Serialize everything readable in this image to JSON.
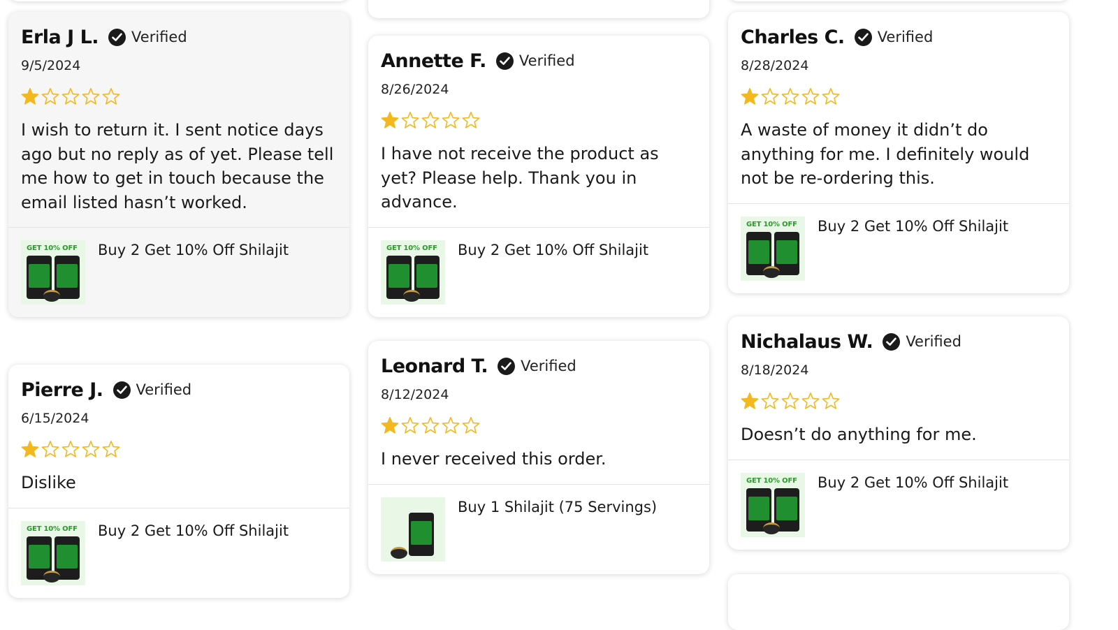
{
  "verified_label": "Verified",
  "colors": {
    "star": "#f2b81d",
    "card": "#ffffff",
    "card_shaded": "#f6f6f6"
  },
  "icons": {
    "verified": "check-circle-icon",
    "star_filled": "star-filled-icon",
    "star_empty": "star-outline-icon"
  },
  "reviews": [
    {
      "name": "Erla J L.",
      "date": "9/5/2024",
      "rating": 1,
      "max_rating": 5,
      "text": "I wish to return it. I sent notice days ago but no reply as of yet. Please tell me how to get in touch because the email listed hasn’t worked.",
      "product": "Buy 2 Get 10% Off Shilajit",
      "product_badge": "GET 10% OFF"
    },
    {
      "name": "Pierre J.",
      "date": "6/15/2024",
      "rating": 1,
      "max_rating": 5,
      "text": "Dislike",
      "product": "Buy 2 Get 10% Off Shilajit",
      "product_badge": "GET 10% OFF"
    },
    {
      "name": "Annette F.",
      "date": "8/26/2024",
      "rating": 1,
      "max_rating": 5,
      "text": "I have not receive the product as yet? Please help. Thank you in advance.",
      "product": "Buy 2 Get 10% Off Shilajit",
      "product_badge": "GET 10% OFF"
    },
    {
      "name": "Leonard T.",
      "date": "8/12/2024",
      "rating": 1,
      "max_rating": 5,
      "text": "I never received this order.",
      "product": "Buy 1 Shilajit (75 Servings)",
      "product_badge": ""
    },
    {
      "name": "Charles C.",
      "date": "8/28/2024",
      "rating": 1,
      "max_rating": 5,
      "text": "A waste of money it didn’t do anything for me. I definitely would not be re-ordering this.",
      "product": "Buy 2 Get 10% Off Shilajit",
      "product_badge": "GET 10% OFF"
    },
    {
      "name": "Nichalaus W.",
      "date": "8/18/2024",
      "rating": 1,
      "max_rating": 5,
      "text": "Doesn’t do anything for me.",
      "product": "Buy 2 Get 10% Off Shilajit",
      "product_badge": "GET 10% OFF"
    }
  ]
}
